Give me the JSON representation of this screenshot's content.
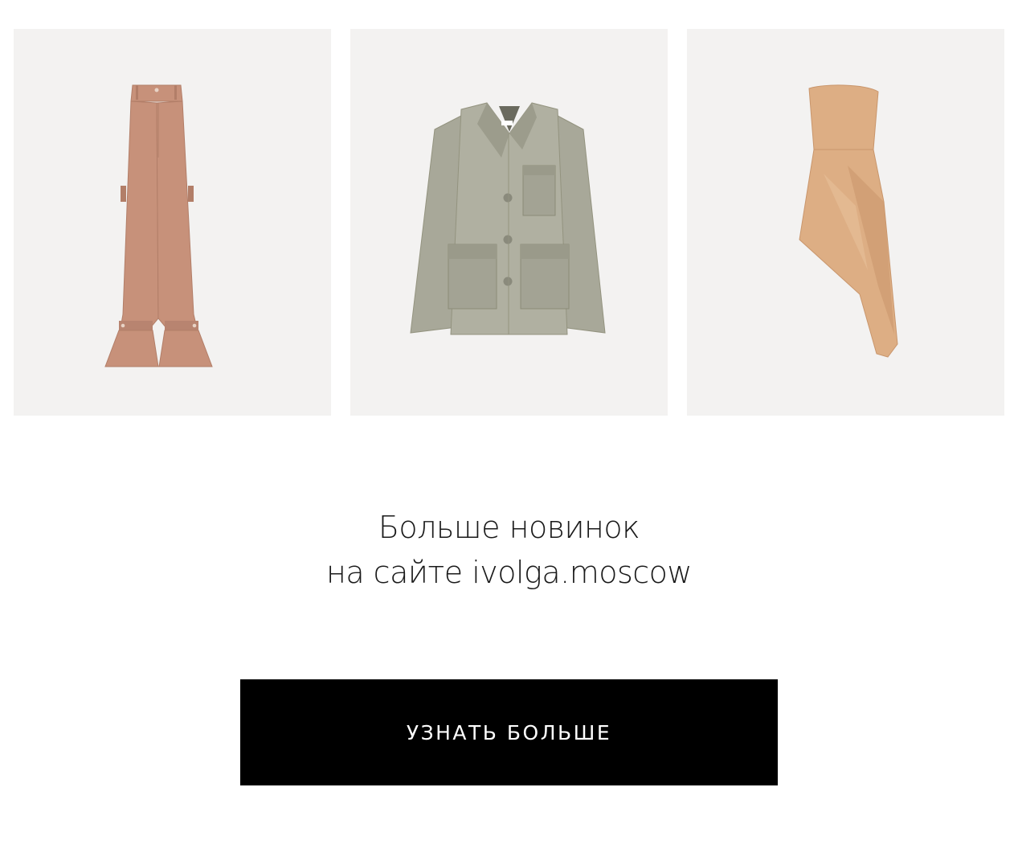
{
  "products": [
    {
      "id": "pants",
      "color": "#c7917a",
      "shade": "#b27e68",
      "name_icon": "pants-image"
    },
    {
      "id": "jacket",
      "color": "#a8a899",
      "shade": "#93937f",
      "name_icon": "jacket-image"
    },
    {
      "id": "dress",
      "color": "#ddae84",
      "shade": "#c9966c",
      "name_icon": "dress-image"
    }
  ],
  "promo": {
    "line1": "Больше новинок",
    "line2": "на сайте ivolga.moscow"
  },
  "cta": {
    "label": "УЗНАТЬ БОЛЬШЕ"
  },
  "colors": {
    "card_bg": "#f3f2f1",
    "button_bg": "#000000",
    "button_text": "#ffffff",
    "text": "#1a1a1a"
  }
}
